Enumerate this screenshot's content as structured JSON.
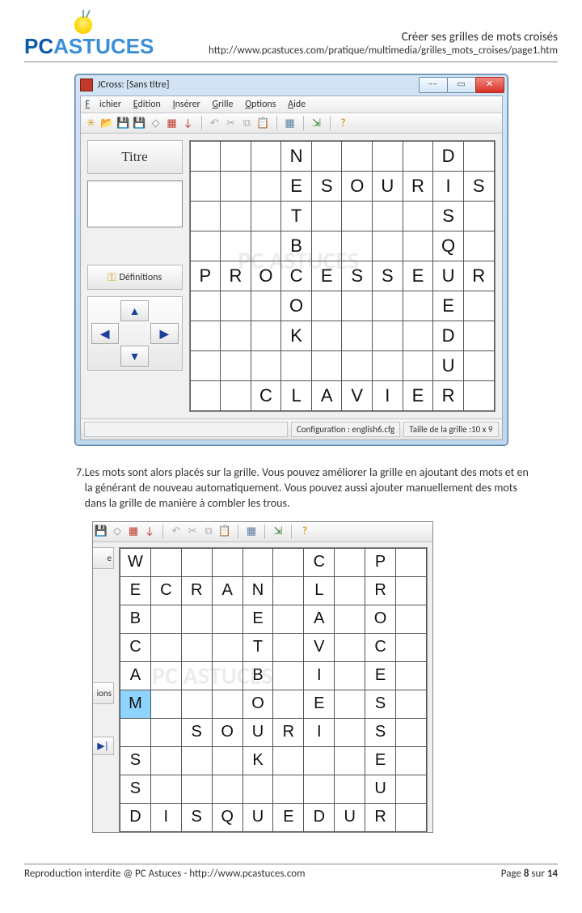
{
  "header": {
    "logo_pc": "PC",
    "logo_astuces": "ASTUCES",
    "title": "Créer ses grilles de mots croisés",
    "url": "http://www.pcastuces.com/pratique/multimedia/grilles_mots_croises/page1.htm"
  },
  "window1": {
    "title": "JCross: [Sans titre]",
    "menu": {
      "fichier": "Fichier",
      "edition": "Edition",
      "inserer": "Insérer",
      "grille": "Grille",
      "options": "Options",
      "aide": "Aide"
    },
    "left": {
      "titre": "Titre",
      "definitions": "Définitions"
    },
    "status": {
      "config": "Configuration : english6.cfg",
      "size": "Taille de la grille :10 x 9"
    },
    "grid": [
      [
        "",
        "",
        "",
        "N",
        "",
        "",
        "",
        "",
        "D",
        ""
      ],
      [
        "",
        "",
        "",
        "E",
        "S",
        "O",
        "U",
        "R",
        "I",
        "S"
      ],
      [
        "",
        "",
        "",
        "T",
        "",
        "",
        "",
        "",
        "S",
        ""
      ],
      [
        "",
        "",
        "",
        "B",
        "",
        "",
        "",
        "",
        "Q",
        ""
      ],
      [
        "P",
        "R",
        "O",
        "C",
        "E",
        "S",
        "S",
        "E",
        "U",
        "R"
      ],
      [
        "",
        "",
        "",
        "O",
        "",
        "",
        "",
        "",
        "E",
        ""
      ],
      [
        "",
        "",
        "",
        "K",
        "",
        "",
        "",
        "",
        "D",
        ""
      ],
      [
        "",
        "",
        "",
        "",
        "",
        "",
        "",
        "",
        "U",
        ""
      ],
      [
        "",
        "",
        "C",
        "L",
        "A",
        "V",
        "I",
        "E",
        "R",
        ""
      ]
    ]
  },
  "step": {
    "num": "7.",
    "text": "Les mots sont alors placés sur la grille. Vous pouvez améliorer la grille en ajoutant des mots et en la générant de nouveau automatiquement. Vous pouvez aussi ajouter manuellement des mots dans la grille de manière à combler les trous."
  },
  "window2": {
    "left_fragments": {
      "titre_end": "e",
      "def_end": "ions",
      "arrow": "▶│"
    },
    "grid": [
      [
        "W",
        "",
        "",
        "",
        "",
        "",
        "C",
        "",
        "P",
        ""
      ],
      [
        "E",
        "C",
        "R",
        "A",
        "N",
        "",
        "L",
        "",
        "R",
        ""
      ],
      [
        "B",
        "",
        "",
        "",
        "E",
        "",
        "A",
        "",
        "O",
        ""
      ],
      [
        "C",
        "",
        "",
        "",
        "T",
        "",
        "V",
        "",
        "C",
        ""
      ],
      [
        "A",
        "",
        "",
        "",
        "B",
        "",
        "I",
        "",
        "E",
        ""
      ],
      [
        "M",
        "",
        "",
        "",
        "O",
        "",
        "E",
        "",
        "S",
        ""
      ],
      [
        "",
        "",
        "S",
        "O",
        "U",
        "R",
        "I",
        "",
        "S",
        ""
      ],
      [
        "S",
        "",
        "",
        "",
        "K",
        "",
        "",
        "",
        "E",
        ""
      ],
      [
        "S",
        "",
        "",
        "",
        "",
        "",
        "",
        "",
        "U",
        ""
      ],
      [
        "D",
        "I",
        "S",
        "Q",
        "U",
        "E",
        "D",
        "U",
        "R",
        ""
      ]
    ],
    "highlight": {
      "row": 5,
      "col": 0
    }
  },
  "footer": {
    "left": "Reproduction interdite @ PC Astuces - http://www.pcastuces.com",
    "right_prefix": "Page ",
    "page_current": "8",
    "right_mid": " sur ",
    "page_total": "14"
  }
}
